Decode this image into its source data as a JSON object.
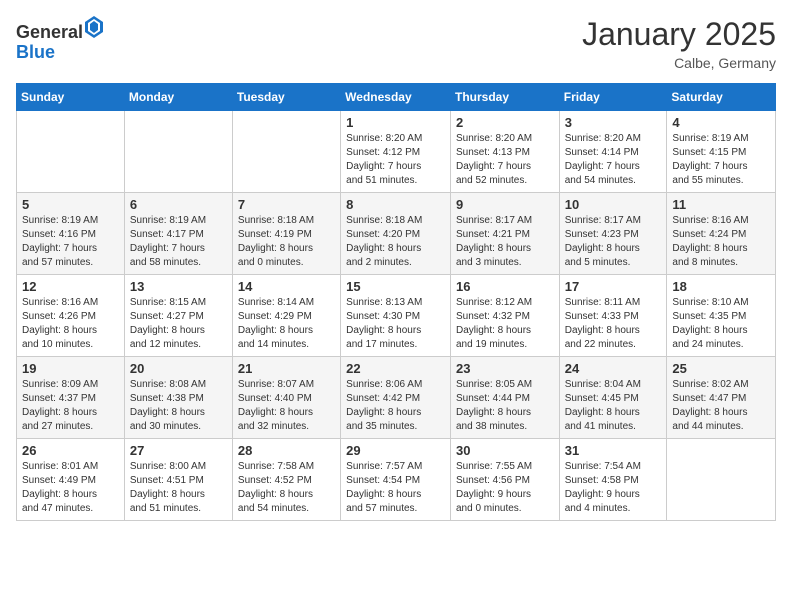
{
  "header": {
    "logo_line1": "General",
    "logo_line2": "Blue",
    "month": "January 2025",
    "location": "Calbe, Germany"
  },
  "days_of_week": [
    "Sunday",
    "Monday",
    "Tuesday",
    "Wednesday",
    "Thursday",
    "Friday",
    "Saturday"
  ],
  "weeks": [
    [
      {
        "day": "",
        "info": ""
      },
      {
        "day": "",
        "info": ""
      },
      {
        "day": "",
        "info": ""
      },
      {
        "day": "1",
        "info": "Sunrise: 8:20 AM\nSunset: 4:12 PM\nDaylight: 7 hours\nand 51 minutes."
      },
      {
        "day": "2",
        "info": "Sunrise: 8:20 AM\nSunset: 4:13 PM\nDaylight: 7 hours\nand 52 minutes."
      },
      {
        "day": "3",
        "info": "Sunrise: 8:20 AM\nSunset: 4:14 PM\nDaylight: 7 hours\nand 54 minutes."
      },
      {
        "day": "4",
        "info": "Sunrise: 8:19 AM\nSunset: 4:15 PM\nDaylight: 7 hours\nand 55 minutes."
      }
    ],
    [
      {
        "day": "5",
        "info": "Sunrise: 8:19 AM\nSunset: 4:16 PM\nDaylight: 7 hours\nand 57 minutes."
      },
      {
        "day": "6",
        "info": "Sunrise: 8:19 AM\nSunset: 4:17 PM\nDaylight: 7 hours\nand 58 minutes."
      },
      {
        "day": "7",
        "info": "Sunrise: 8:18 AM\nSunset: 4:19 PM\nDaylight: 8 hours\nand 0 minutes."
      },
      {
        "day": "8",
        "info": "Sunrise: 8:18 AM\nSunset: 4:20 PM\nDaylight: 8 hours\nand 2 minutes."
      },
      {
        "day": "9",
        "info": "Sunrise: 8:17 AM\nSunset: 4:21 PM\nDaylight: 8 hours\nand 3 minutes."
      },
      {
        "day": "10",
        "info": "Sunrise: 8:17 AM\nSunset: 4:23 PM\nDaylight: 8 hours\nand 5 minutes."
      },
      {
        "day": "11",
        "info": "Sunrise: 8:16 AM\nSunset: 4:24 PM\nDaylight: 8 hours\nand 8 minutes."
      }
    ],
    [
      {
        "day": "12",
        "info": "Sunrise: 8:16 AM\nSunset: 4:26 PM\nDaylight: 8 hours\nand 10 minutes."
      },
      {
        "day": "13",
        "info": "Sunrise: 8:15 AM\nSunset: 4:27 PM\nDaylight: 8 hours\nand 12 minutes."
      },
      {
        "day": "14",
        "info": "Sunrise: 8:14 AM\nSunset: 4:29 PM\nDaylight: 8 hours\nand 14 minutes."
      },
      {
        "day": "15",
        "info": "Sunrise: 8:13 AM\nSunset: 4:30 PM\nDaylight: 8 hours\nand 17 minutes."
      },
      {
        "day": "16",
        "info": "Sunrise: 8:12 AM\nSunset: 4:32 PM\nDaylight: 8 hours\nand 19 minutes."
      },
      {
        "day": "17",
        "info": "Sunrise: 8:11 AM\nSunset: 4:33 PM\nDaylight: 8 hours\nand 22 minutes."
      },
      {
        "day": "18",
        "info": "Sunrise: 8:10 AM\nSunset: 4:35 PM\nDaylight: 8 hours\nand 24 minutes."
      }
    ],
    [
      {
        "day": "19",
        "info": "Sunrise: 8:09 AM\nSunset: 4:37 PM\nDaylight: 8 hours\nand 27 minutes."
      },
      {
        "day": "20",
        "info": "Sunrise: 8:08 AM\nSunset: 4:38 PM\nDaylight: 8 hours\nand 30 minutes."
      },
      {
        "day": "21",
        "info": "Sunrise: 8:07 AM\nSunset: 4:40 PM\nDaylight: 8 hours\nand 32 minutes."
      },
      {
        "day": "22",
        "info": "Sunrise: 8:06 AM\nSunset: 4:42 PM\nDaylight: 8 hours\nand 35 minutes."
      },
      {
        "day": "23",
        "info": "Sunrise: 8:05 AM\nSunset: 4:44 PM\nDaylight: 8 hours\nand 38 minutes."
      },
      {
        "day": "24",
        "info": "Sunrise: 8:04 AM\nSunset: 4:45 PM\nDaylight: 8 hours\nand 41 minutes."
      },
      {
        "day": "25",
        "info": "Sunrise: 8:02 AM\nSunset: 4:47 PM\nDaylight: 8 hours\nand 44 minutes."
      }
    ],
    [
      {
        "day": "26",
        "info": "Sunrise: 8:01 AM\nSunset: 4:49 PM\nDaylight: 8 hours\nand 47 minutes."
      },
      {
        "day": "27",
        "info": "Sunrise: 8:00 AM\nSunset: 4:51 PM\nDaylight: 8 hours\nand 51 minutes."
      },
      {
        "day": "28",
        "info": "Sunrise: 7:58 AM\nSunset: 4:52 PM\nDaylight: 8 hours\nand 54 minutes."
      },
      {
        "day": "29",
        "info": "Sunrise: 7:57 AM\nSunset: 4:54 PM\nDaylight: 8 hours\nand 57 minutes."
      },
      {
        "day": "30",
        "info": "Sunrise: 7:55 AM\nSunset: 4:56 PM\nDaylight: 9 hours\nand 0 minutes."
      },
      {
        "day": "31",
        "info": "Sunrise: 7:54 AM\nSunset: 4:58 PM\nDaylight: 9 hours\nand 4 minutes."
      },
      {
        "day": "",
        "info": ""
      }
    ]
  ]
}
